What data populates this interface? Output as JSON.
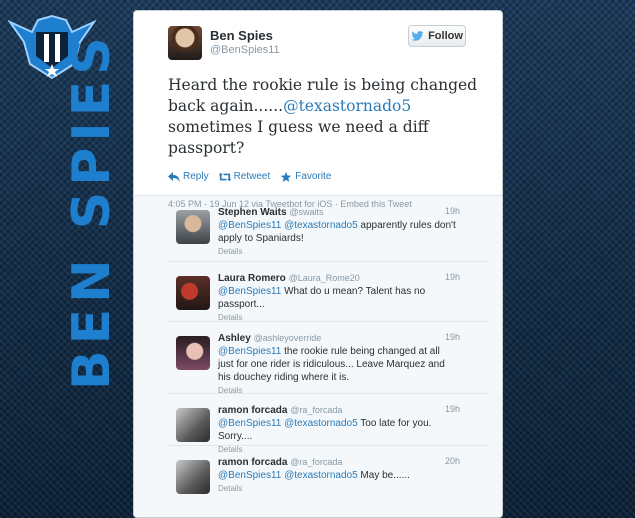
{
  "brand": {
    "wordmark": "BEN SPIES",
    "colors": {
      "accent": "#1e7fcf",
      "background": "#0f2a44"
    }
  },
  "tweet": {
    "author": {
      "name": "Ben Spies",
      "handle": "@BenSpies11"
    },
    "follow_label": "Follow",
    "text_before": "Heard the rookie rule is being changed back again......",
    "mention": "@texastornado5",
    "text_after": " sometimes I guess we need a diff passport?",
    "actions": {
      "reply": "Reply",
      "retweet": "Retweet",
      "favorite": "Favorite"
    },
    "meta": "4:05 PM - 19 Jun 12 via Tweetbot for iOS · Embed this Tweet"
  },
  "replies": [
    {
      "name": "Stephen Waits",
      "handle": "@swaits",
      "time": "19h",
      "mentions": "@BenSpies11 @texastornado5",
      "text": " apparently rules don't apply to Spaniards!",
      "details": "Details"
    },
    {
      "name": "Laura Romero",
      "handle": "@Laura_Rome20",
      "time": "19h",
      "mentions": "@BenSpies11",
      "text": " What do u mean? Talent has no passport...",
      "details": "Details"
    },
    {
      "name": "Ashley",
      "handle": "@ashleyoverride",
      "time": "19h",
      "mentions": "@BenSpies11",
      "text": " the rookie rule being changed at all just for one rider is ridiculous... Leave Marquez and his douchey riding where it is.",
      "details": "Details"
    },
    {
      "name": "ramon forcada",
      "handle": "@ra_forcada",
      "time": "19h",
      "mentions": "@BenSpies11 @texastornado5",
      "text": " Too late for you. Sorry....",
      "details": "Details"
    },
    {
      "name": "ramon forcada",
      "handle": "@ra_forcada",
      "time": "20h",
      "mentions": "@BenSpies11 @texastornado5",
      "text": " May be......",
      "details": "Details"
    }
  ]
}
